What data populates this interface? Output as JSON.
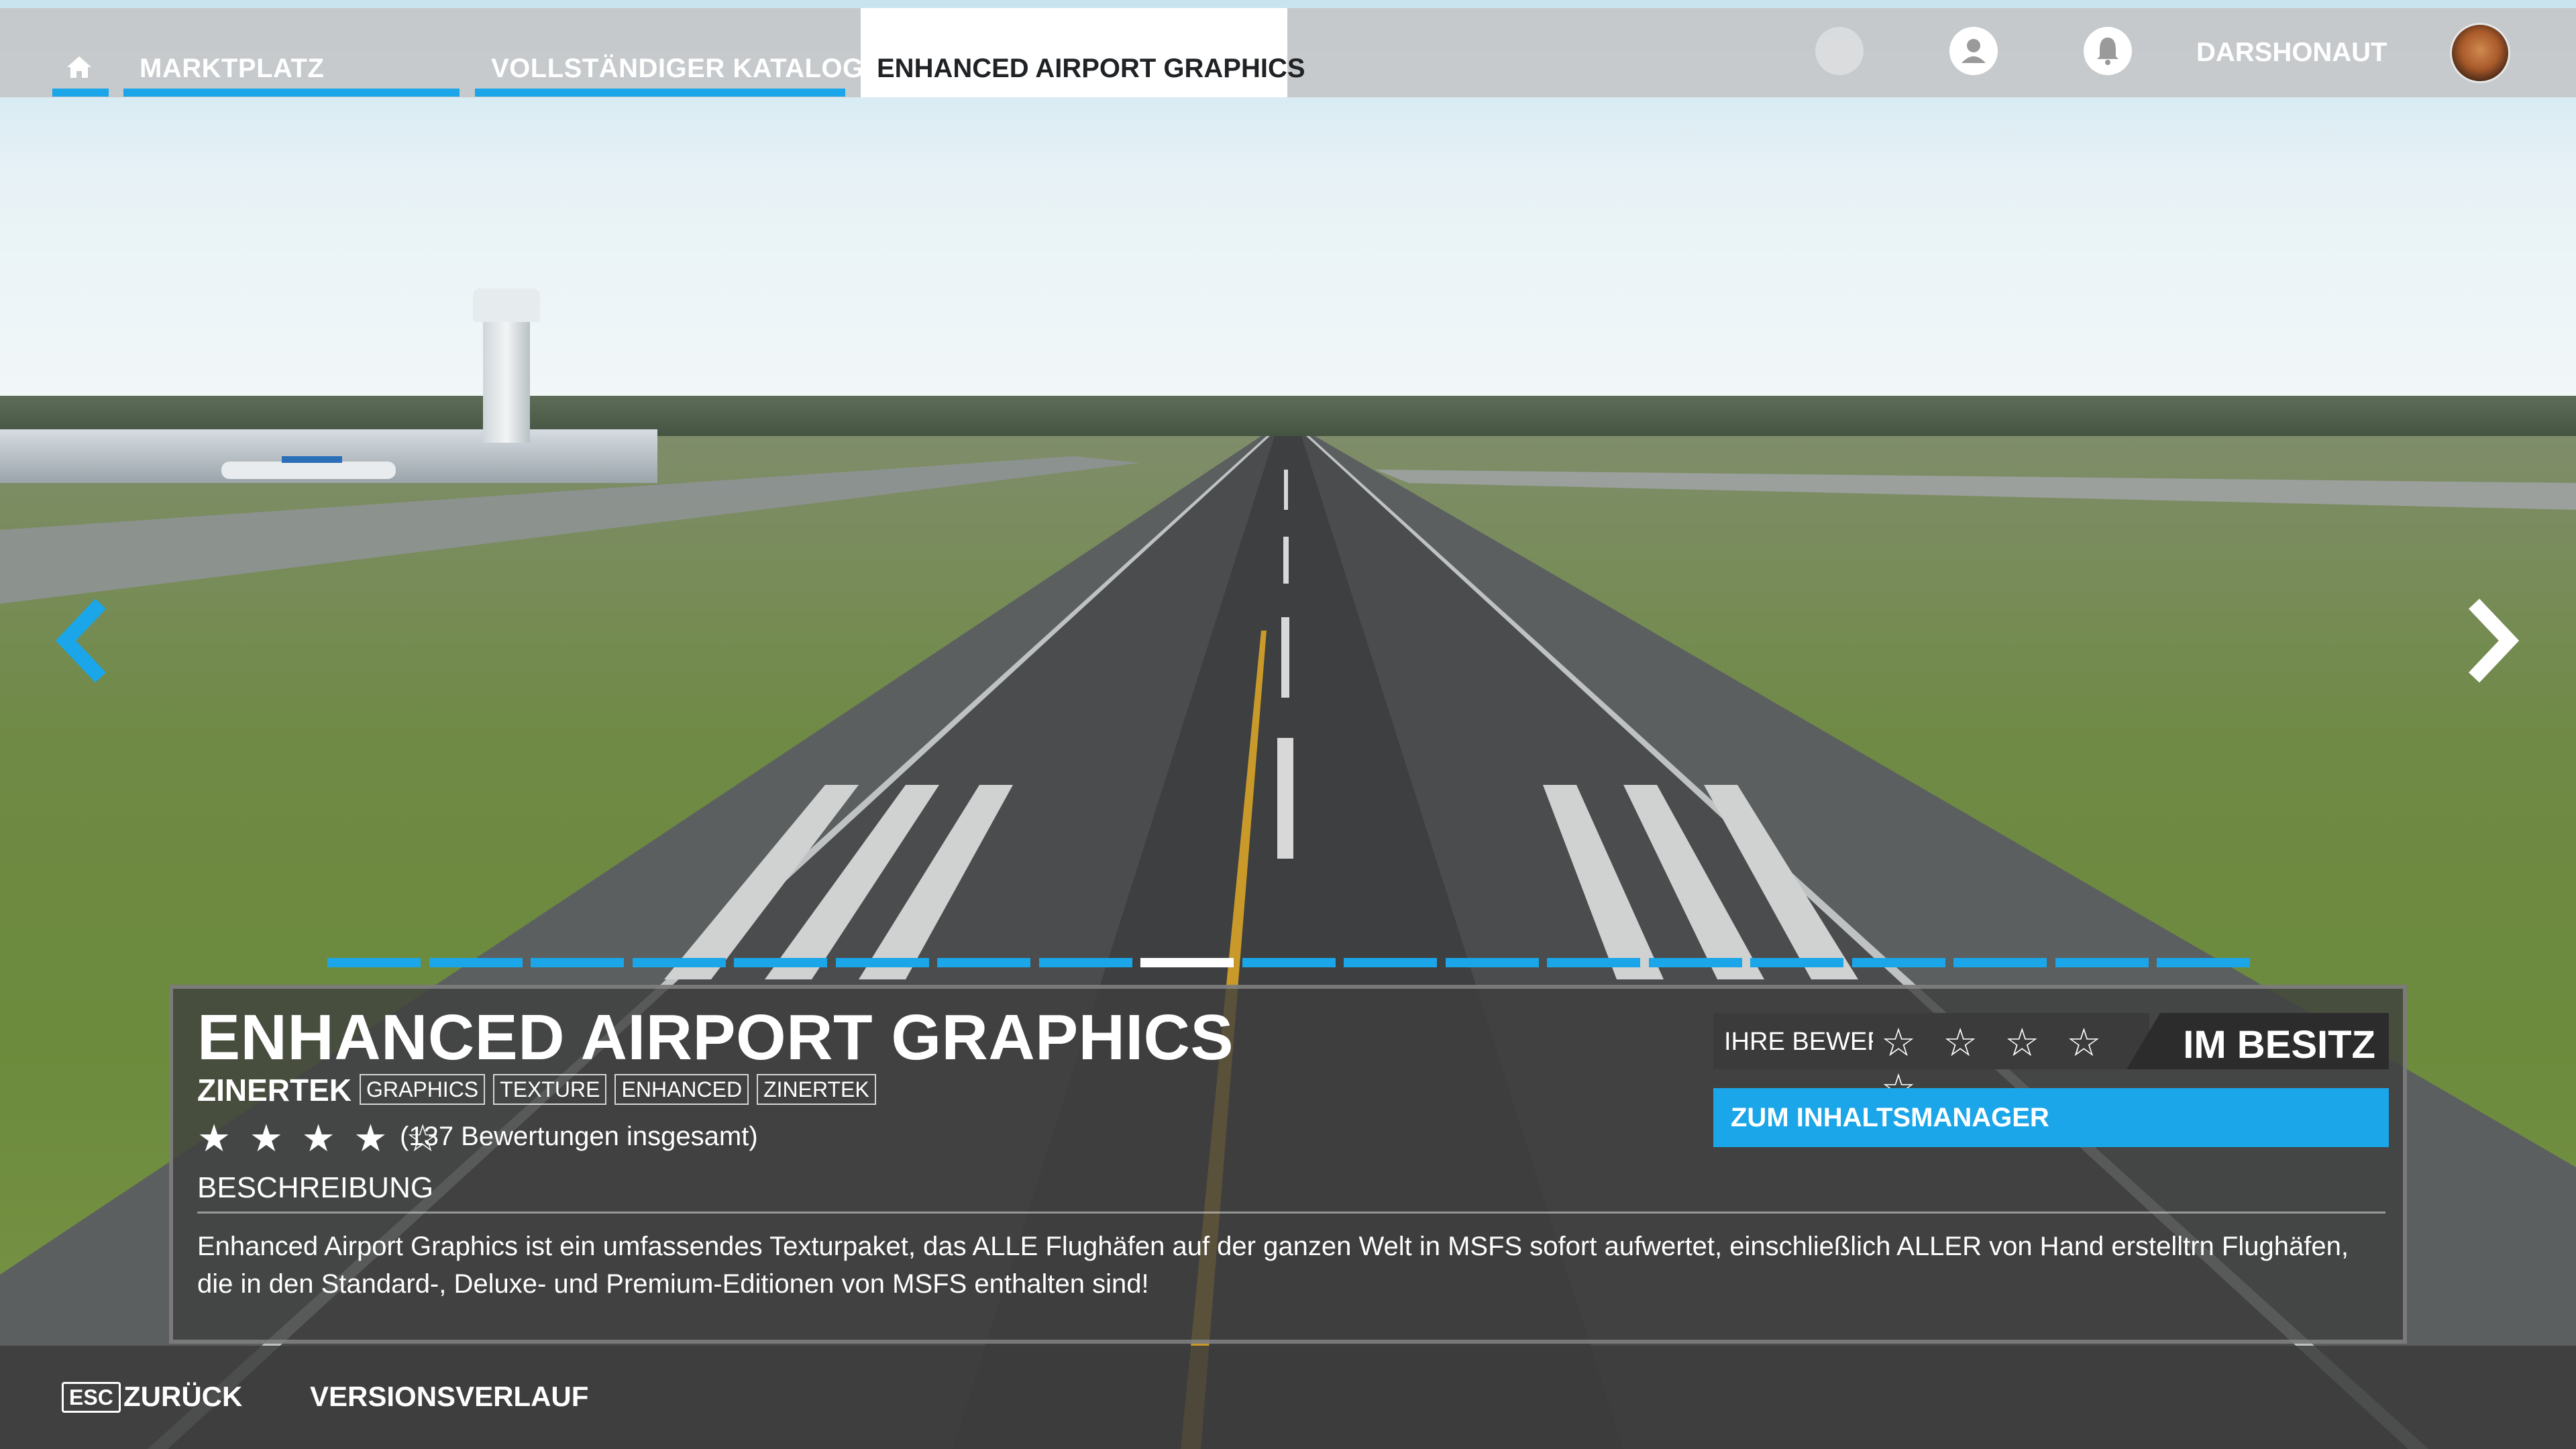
{
  "nav": {
    "tabs": [
      {
        "label": "MARKTPLATZ"
      },
      {
        "label": "VOLLSTÄNDIGER KATALOG"
      },
      {
        "label": "ENHANCED AIRPORT GRAPHICS"
      }
    ],
    "username": "DARSHONAUT",
    "icons": [
      "home-icon",
      "friends-icon",
      "profile-icon",
      "notifications-icon"
    ]
  },
  "carousel": {
    "slide_count": 19,
    "active_index": 8
  },
  "product": {
    "title": "ENHANCED AIRPORT GRAPHICS",
    "publisher": "ZINERTEK",
    "tags": [
      "GRAPHICS",
      "TEXTURE",
      "ENHANCED",
      "ZINERTEK"
    ],
    "rating_stars": "★ ★ ★ ★ ☆",
    "rating_value": 4,
    "rating_count": "(137 Bewertungen insgesamt)",
    "description_label": "BESCHREIBUNG",
    "description": "Enhanced Airport Graphics ist ein umfassendes Texturpaket, das ALLE Flughäfen auf der ganzen Welt in MSFS sofort aufwertet, einschließlich ALLER von Hand erstelltrn Flughäfen, die in den Standard-, Deluxe- und Premium-Editionen von MSFS enthalten sind!",
    "your_rating_label": "IHRE BEWERTUNG",
    "your_rating_stars": "☆ ☆ ☆ ☆ ☆",
    "owned_label": "IM BESITZ",
    "content_manager_button": "ZUM INHALTSMANAGER"
  },
  "bottom_bar": {
    "esc_key": "ESC",
    "back_label": "ZURÜCK",
    "history_label": "VERSIONSVERLAUF"
  },
  "colors": {
    "accent": "#1aa6e8",
    "panel": "#3e3e3e",
    "white": "#ffffff"
  }
}
